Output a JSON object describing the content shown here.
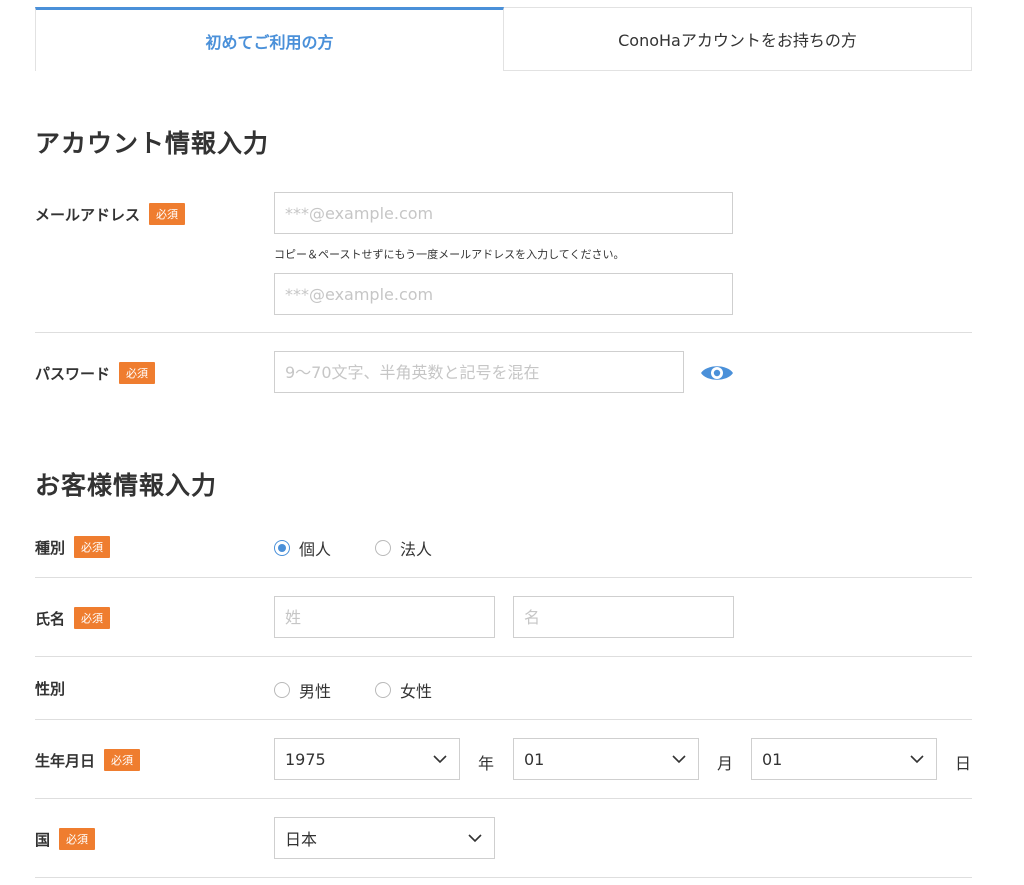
{
  "tabs": {
    "first_time": "初めてご利用の方",
    "has_account": "ConoHaアカウントをお持ちの方"
  },
  "account_section": {
    "title": "アカウント情報入力",
    "email": {
      "label": "メールアドレス",
      "required": "必須",
      "placeholder": "***@example.com",
      "hint": "コピー＆ペーストせずにもう一度メールアドレスを入力してください。",
      "confirm_placeholder": "***@example.com"
    },
    "password": {
      "label": "パスワード",
      "required": "必須",
      "placeholder": "9〜70文字、半角英数と記号を混在",
      "toggle_icon": "eye-icon"
    }
  },
  "customer_section": {
    "title": "お客様情報入力",
    "type": {
      "label": "種別",
      "required": "必須",
      "options": [
        "個人",
        "法人"
      ],
      "selected": "個人"
    },
    "name": {
      "label": "氏名",
      "required": "必須",
      "last_placeholder": "姓",
      "first_placeholder": "名"
    },
    "gender": {
      "label": "性別",
      "options": [
        "男性",
        "女性"
      ]
    },
    "birthday": {
      "label": "生年月日",
      "required": "必須",
      "year": "1975",
      "year_unit": "年",
      "month": "01",
      "month_unit": "月",
      "day": "01",
      "day_unit": "日"
    },
    "country": {
      "label": "国",
      "required": "必須",
      "value": "日本"
    }
  },
  "colors": {
    "accent": "#4a90d9",
    "required_badge": "#ef7d2f",
    "divider": "#dedede"
  }
}
